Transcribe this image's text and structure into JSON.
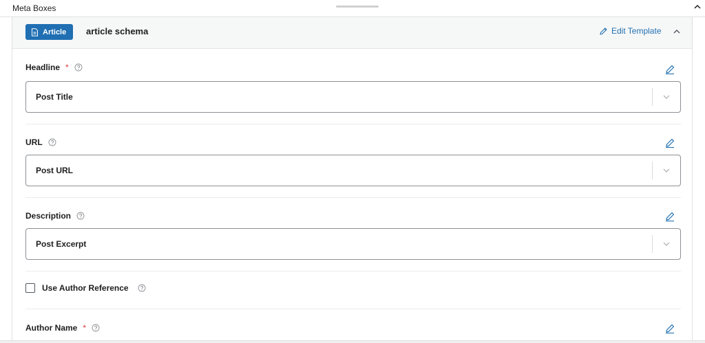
{
  "topbar": {
    "title": "Meta Boxes"
  },
  "schema": {
    "badge_label": "Article",
    "name": "article schema",
    "edit_template_label": "Edit Template"
  },
  "fields": [
    {
      "label": "Headline",
      "required": true,
      "value": "Post Title"
    },
    {
      "label": "URL",
      "required": false,
      "value": "Post URL"
    },
    {
      "label": "Description",
      "required": false,
      "value": "Post Excerpt"
    }
  ],
  "author_reference": {
    "label": "Use Author Reference",
    "checked": false
  },
  "author_name": {
    "label": "Author Name",
    "required": true
  },
  "required_marker": "*",
  "colors": {
    "accent": "#2271b1",
    "badge": "#1f6fb2",
    "required": "#d63638"
  }
}
